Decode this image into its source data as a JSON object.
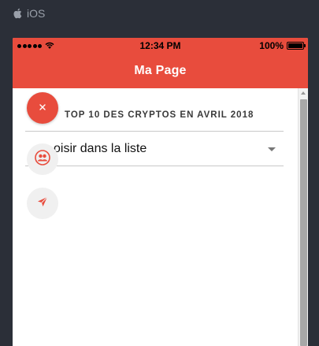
{
  "platform": {
    "label": "iOS",
    "icon": "apple-icon"
  },
  "status_bar": {
    "time": "12:34 PM",
    "battery": "100%",
    "battery_level": 1.0
  },
  "nav": {
    "title": "Ma Page"
  },
  "content": {
    "list_title": "TOP 10 DES CRYPTOS EN AVRIL 2018",
    "select": {
      "placeholder": "Choisir dans la liste",
      "visible_text": "oisir dans la liste"
    }
  },
  "fab": {
    "main_icon": "close-icon",
    "actions": [
      {
        "icon": "users-icon"
      },
      {
        "icon": "send-icon"
      }
    ]
  },
  "colors": {
    "accent": "#e84c3d",
    "background": "#2b2f38"
  }
}
